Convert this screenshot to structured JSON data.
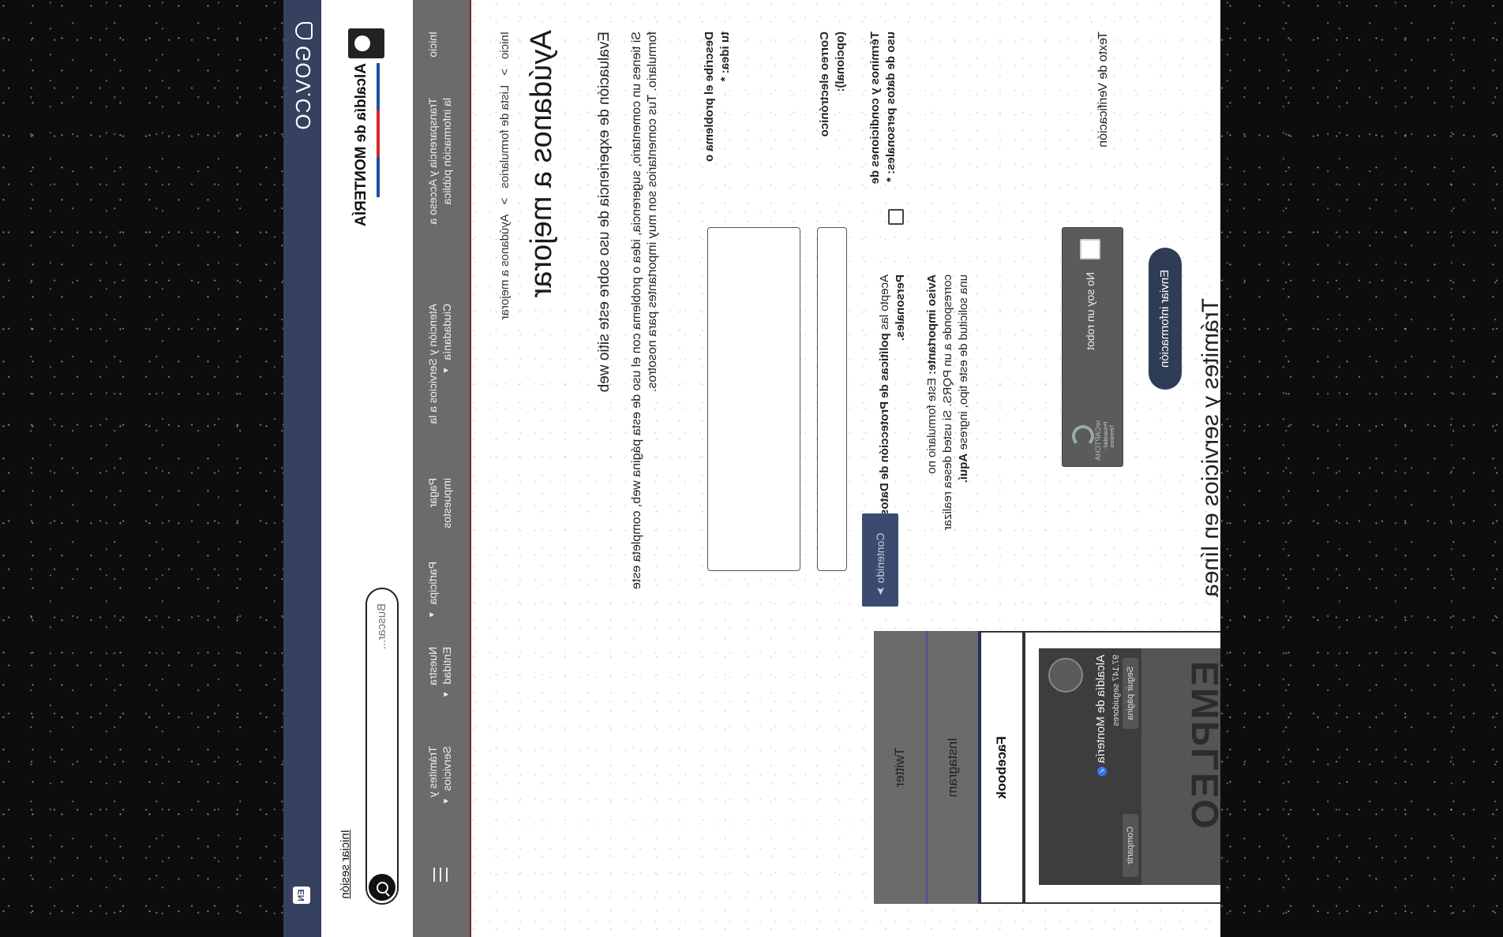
{
  "govbar": {
    "logo_text": "GOV.CO",
    "lang_button": "EN"
  },
  "header": {
    "brand_name": "Alcaldía de MONTERÍA",
    "search_placeholder": "Buscar...",
    "login_label": "Iniciar sesión"
  },
  "nav": {
    "items": [
      {
        "label": "Inicio"
      },
      {
        "label": "Transparencia y Acceso a la información pública"
      },
      {
        "label": "Atención y Servicios a la Ciudadanía"
      },
      {
        "label": "Pagar impuestos"
      },
      {
        "label": "Participa"
      },
      {
        "label": "Nuestra Entidad"
      },
      {
        "label": "Trámites y Servicios"
      }
    ]
  },
  "breadcrumb": {
    "items": [
      "Inicio",
      "Lista de formularios",
      "Ayúdanos a mejorar"
    ],
    "separator": ">"
  },
  "page": {
    "title": "Ayúdanos a mejorar",
    "subheading": "Evaluación de experiencia de uso sobre este sitio web",
    "intro": "Si tienes un comentario, sugerencia, idea o problema con el uso de esta página web, completa este formulario. Tus comentarios son muy importantes para nosotros."
  },
  "form": {
    "description_label": "Describe el problema o tu idea: *",
    "email_label": "Correo electrónico (opcional):",
    "terms_label": "Términos y condiciones de uso de datos personales: *",
    "accept_prefix": "Acepto las",
    "accept_link": "políticas de Protección de Datos Personales.",
    "warning_strong": "Aviso importante:",
    "warning_text": "Este formulario no corresponde a un PQRS. Si usted desea realizar una solicitud de este tipo, ingrese",
    "warning_link": "Aquí.",
    "captcha_label": "Texto de Verificación",
    "captcha_text": "No soy un robot",
    "captcha_brand": "reCAPTCHA",
    "captcha_terms": "Privacidad - Términos",
    "submit_label": "Enviar información",
    "more_label": "Contenido"
  },
  "social": {
    "tabs": [
      "Twitter",
      "Instagram",
      "Facebook"
    ],
    "page_name": "Alcaldía de Montería",
    "followers": "97.147 seguidores",
    "follow_label": "Seguir página",
    "share_label": "Compartir",
    "video_headline": "EMPLEO ANIMATE Y ANIMATE"
  },
  "section": {
    "tramites_title": "Trámites y servicios en línea"
  }
}
